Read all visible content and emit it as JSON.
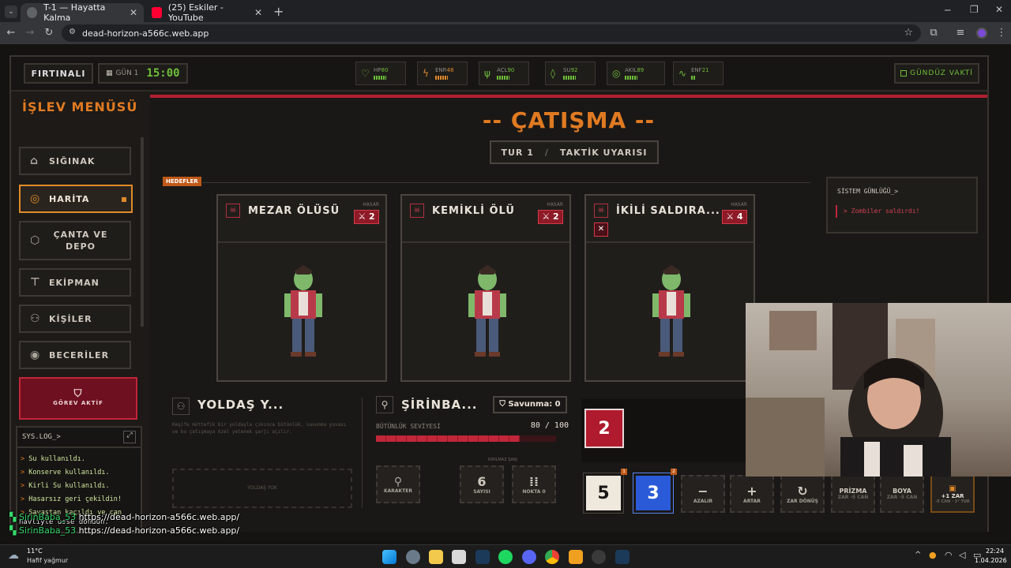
{
  "browser": {
    "tabs": [
      {
        "label": "T-1 — Hayatta Kalma"
      },
      {
        "label": "(25) Eskiler - YouTube"
      }
    ],
    "url": "dead-horizon-a566c.web.app"
  },
  "hud": {
    "weather": "FIRTINALI",
    "day": "GÜN 1",
    "clock": "15:00",
    "stats": [
      {
        "label": "HP",
        "value": "80",
        "icon": "heart-icon",
        "fill": 0.8
      },
      {
        "label": "ENR",
        "value": "48",
        "icon": "lightning-icon",
        "fill": 0.48
      },
      {
        "label": "AÇL",
        "value": "90",
        "icon": "fork-knife-icon",
        "fill": 0.9
      },
      {
        "label": "SU",
        "value": "92",
        "icon": "droplet-icon",
        "fill": 0.92
      },
      {
        "label": "AKIL",
        "value": "89",
        "icon": "brain-icon",
        "fill": 0.89
      },
      {
        "label": "ENF",
        "value": "21",
        "icon": "pulse-icon",
        "fill": 0.21
      }
    ],
    "daytime": "GÜNDÜZ VAKTİ",
    "accent": "#6fbf3a"
  },
  "menu": {
    "title": "İŞLEV MENÜSÜ",
    "items": [
      {
        "label": "SIĞINAK",
        "icon": "house-icon"
      },
      {
        "label": "HARİTA",
        "icon": "compass-icon"
      },
      {
        "label": "ÇANTA VE DEPO",
        "icon": "box-icon"
      },
      {
        "label": "EKİPMAN",
        "icon": "shirt-icon"
      },
      {
        "label": "KİŞİLER",
        "icon": "people-icon"
      },
      {
        "label": "BECERİLER",
        "icon": "target-icon"
      }
    ],
    "task_label": "GÖREV AKTİF"
  },
  "syslog": {
    "title": "SYS.LOG_>",
    "lines": [
      "Su kullanıldı.",
      "Konserve kullanıldı.",
      "Kirli Su kullanıldı.",
      "Hasarsız geri çekildin!",
      "Savaştan kaçıldı ve can"
    ]
  },
  "combat": {
    "title": "-- ÇATIŞMA --",
    "round": "TUR 1",
    "sep": "/",
    "phase": "TAKTİK UYARISI",
    "targets_label": "HEDEFLER",
    "damage_label": "HASAR",
    "enemies": [
      {
        "name": "MEZAR ÖLÜSÜ",
        "damage": "2"
      },
      {
        "name": "KEMİKLİ ÖLÜ",
        "damage": "2"
      },
      {
        "name": "İKİLİ SALDIRA...",
        "damage": "4"
      }
    ]
  },
  "system_log": {
    "title": "SİSTEM GÜNLÜĞÜ_>",
    "entry": "> Zombiler saldırdı!"
  },
  "companion": {
    "title": "YOLDAŞ Y...",
    "desc": "Keşife müttefik bir yoldaşla çıkınca bütünlük, savunma yuvası ve bu çatışmaya özel yetenek şarjı açılır.",
    "slot": "YOLDAŞ YOK"
  },
  "player": {
    "name": "ŞİRİNBA...",
    "defense": "Savunma: 0",
    "integrity_label": "BÜTÜNLÜK SEVİYESİ",
    "integrity": "80 / 100",
    "integrity_fill": 0.8,
    "charge_label": "KIRILMAZ ŞARJ",
    "character_label": "KARAKTER",
    "count_value": "6",
    "count_label": "SAYISI",
    "points_label": "NOKTA 0"
  },
  "dice": {
    "enemy_die": "2",
    "die_a": "5",
    "die_a_badge": "1",
    "die_b": "3",
    "die_b_badge": "2",
    "actions": [
      {
        "label": "AZALIR",
        "icon": "−"
      },
      {
        "label": "ARTAR",
        "icon": "+"
      },
      {
        "label": "ZAR DÖNÜŞ",
        "icon": "↻"
      },
      {
        "label": "PRİZMA",
        "sub": "ZAR -5 CAN"
      },
      {
        "label": "BOYA",
        "sub": "ZAR -5 CAN"
      },
      {
        "label": "+1 ZAR",
        "sub": "-5 CAN · 1* TUR"
      }
    ]
  },
  "chat": [
    {
      "user": "SirinBaba_53",
      "text": "https://dead-horizon-a566c.web.app/"
    },
    {
      "user": "SirinBaba_53",
      "text": "https://dead-horizon-a566c.web.app/"
    }
  ],
  "overlay_text": "havliyle üsse döndün.",
  "taskbar": {
    "temp": "11°C",
    "weather": "Hafif yağmur",
    "time": "22:24",
    "date": "1.04.2026"
  }
}
